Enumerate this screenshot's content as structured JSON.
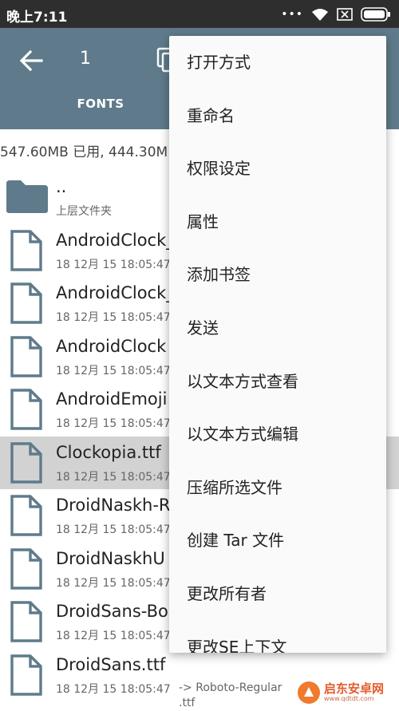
{
  "status": {
    "time": "晚上7:11",
    "dots": "•••"
  },
  "appbar": {
    "selected_count": "1",
    "tab_label": "FONTS"
  },
  "storage_info": "547.60MB 已用, 444.30M",
  "files": [
    {
      "name": "..",
      "meta": "上层文件夹",
      "type": "folder"
    },
    {
      "name": "AndroidClock_",
      "meta": "18 12月 15 18:05:47",
      "type": "file"
    },
    {
      "name": "AndroidClock_",
      "meta": "18 12月 15 18:05:47",
      "type": "file"
    },
    {
      "name": "AndroidClock",
      "meta": "18 12月 15 18:05:47",
      "type": "file"
    },
    {
      "name": "AndroidEmoji",
      "meta": "18 12月 15 18:05:47",
      "type": "file"
    },
    {
      "name": "Clockopia.ttf",
      "meta": "18 12月 15 18:05:47",
      "type": "file",
      "selected": true
    },
    {
      "name": "DroidNaskh-R",
      "meta": "18 12月 15 18:05:47",
      "type": "file"
    },
    {
      "name": "DroidNaskhU",
      "meta": "18 12月 15 18:05:47",
      "type": "file"
    },
    {
      "name": "DroidSans-Bo",
      "meta": "18 12月 15 18:05:47",
      "type": "file"
    },
    {
      "name": "DroidSans.ttf",
      "meta": "18 12月 15 18:05:47",
      "type": "file",
      "link": "-> Roboto-Regular\n.ttf"
    }
  ],
  "menu": {
    "items": [
      "打开方式",
      "重命名",
      "权限设定",
      "属性",
      "添加书签",
      "发送",
      "以文本方式查看",
      "以文本方式编辑",
      "压缩所选文件",
      "创建 Tar 文件",
      "更改所有者",
      "更改SE上下文"
    ]
  },
  "watermark": {
    "name": "启东安卓网",
    "url": "www.qdtdt.com"
  },
  "colors": {
    "appbar": "#5f7b8b",
    "status_bar": "#2e2e2e",
    "icon": "#5f7b8b",
    "selected_row": "#d2d2d2",
    "menu_bg": "#fafafa"
  }
}
